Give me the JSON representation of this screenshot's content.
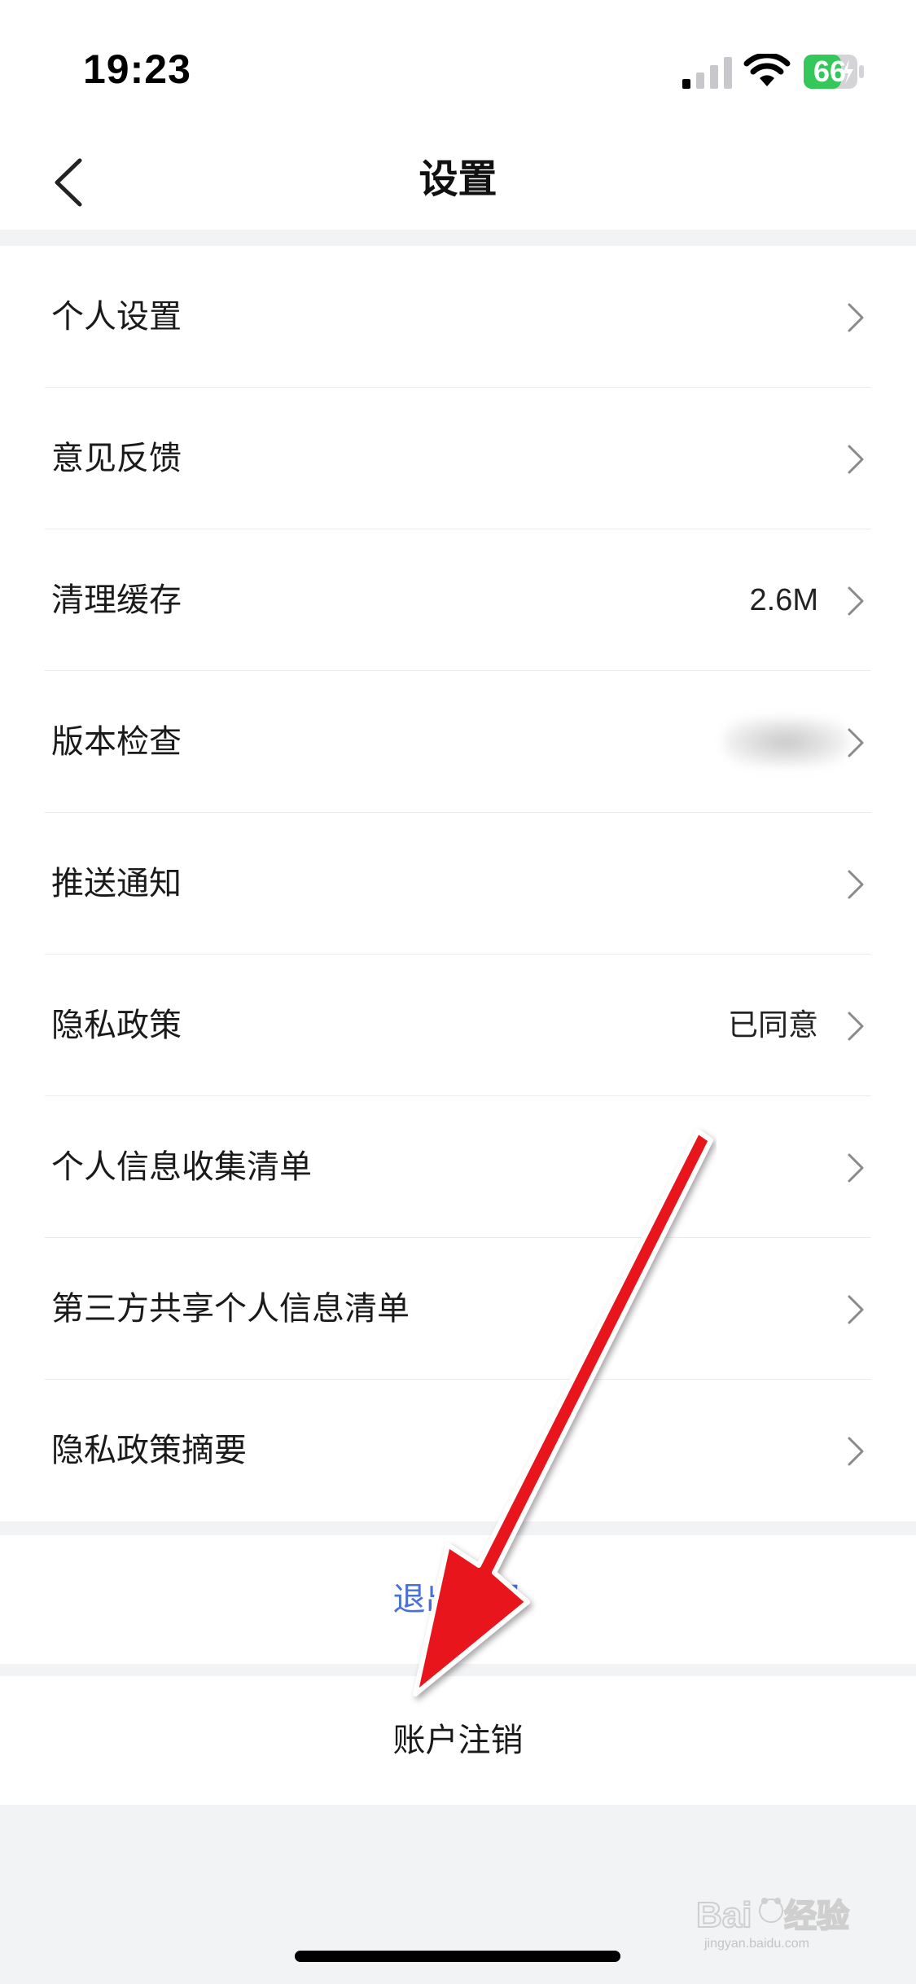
{
  "status_bar": {
    "time": "19:23",
    "battery_level": "66",
    "icons": [
      "signal-icon",
      "wifi-icon",
      "battery-icon"
    ]
  },
  "nav": {
    "title": "设置",
    "back_icon": "chevron-left-icon"
  },
  "settings": {
    "items": [
      {
        "label": "个人设置",
        "value": ""
      },
      {
        "label": "意见反馈",
        "value": ""
      },
      {
        "label": "清理缓存",
        "value": "2.6M"
      },
      {
        "label": "版本检查",
        "value": ""
      },
      {
        "label": "推送通知",
        "value": ""
      },
      {
        "label": "隐私政策",
        "value": "已同意"
      },
      {
        "label": "个人信息收集清单",
        "value": ""
      },
      {
        "label": "第三方共享个人信息清单",
        "value": ""
      },
      {
        "label": "隐私政策摘要",
        "value": ""
      }
    ]
  },
  "actions": {
    "logout": "退出登录",
    "deregister": "账户注销"
  },
  "watermark": {
    "brand": "Baidu经验",
    "url": "jingyan.baidu.com"
  },
  "colors": {
    "background": "#f2f3f5",
    "logout_text": "#4a6fd6",
    "annotation_arrow": "#e8121b",
    "battery": "#34c759"
  }
}
